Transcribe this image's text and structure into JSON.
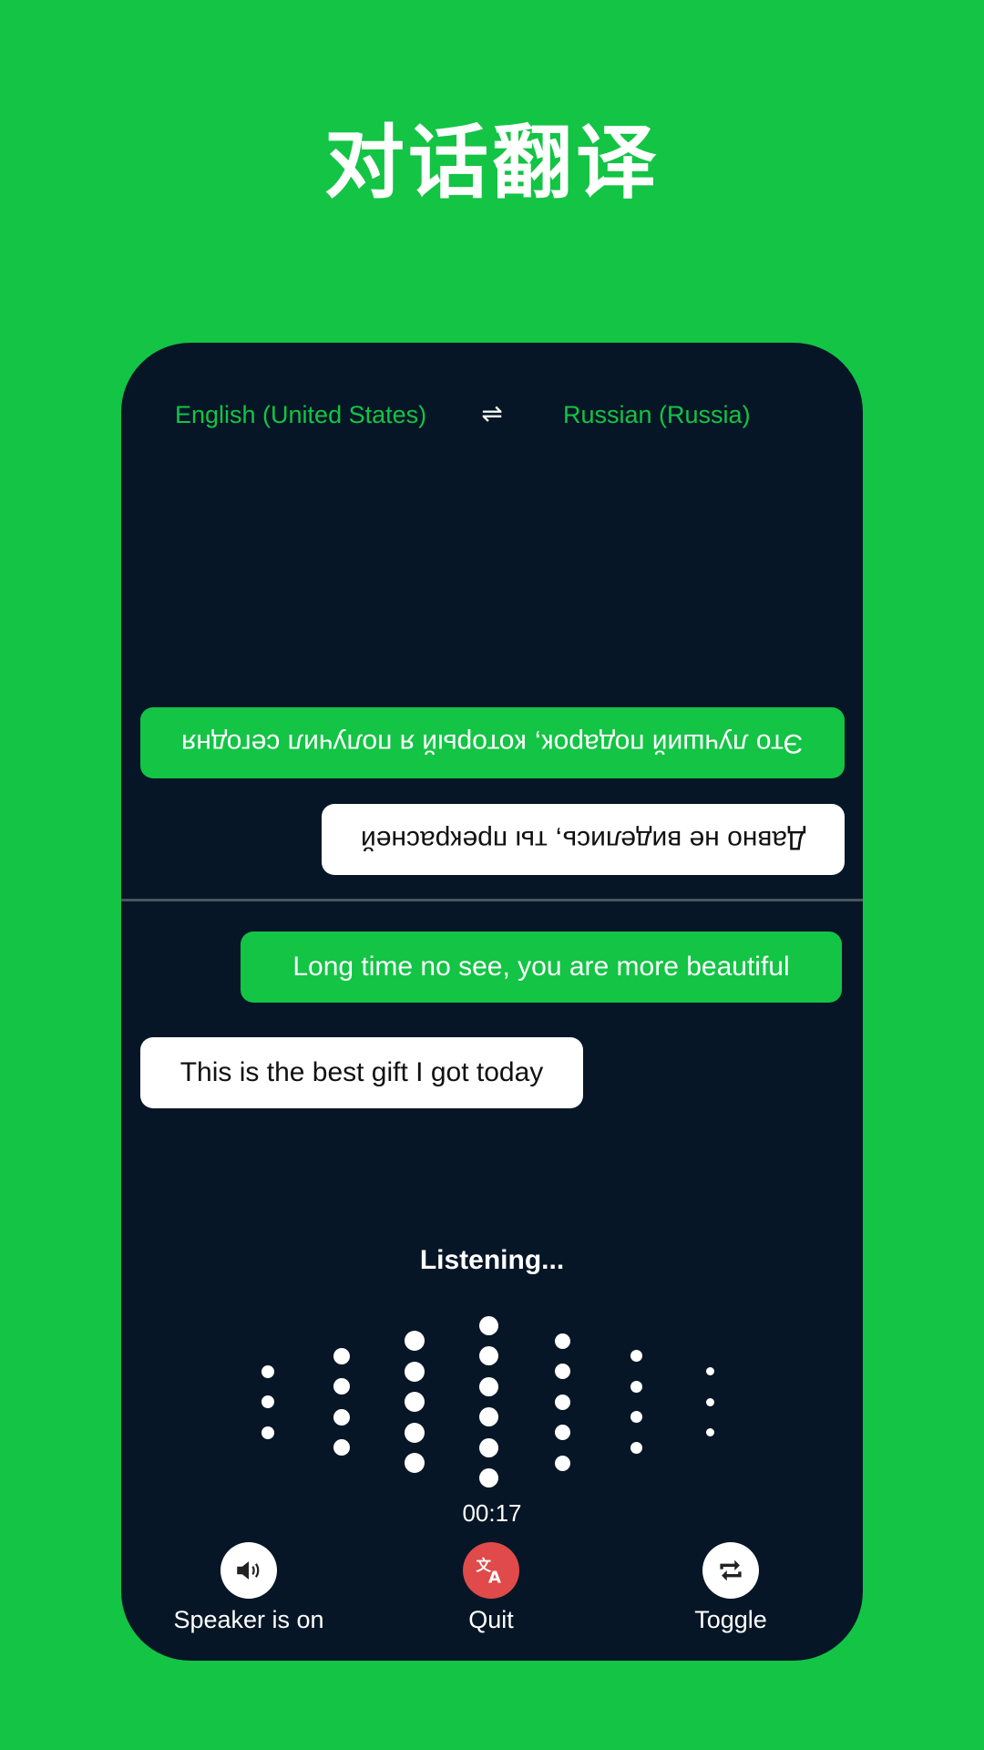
{
  "header": {
    "title": "对话翻译"
  },
  "languages": {
    "source": "English (United States)",
    "target": "Russian (Russia)",
    "swap_icon": "swap-arrows-icon"
  },
  "conversation_top": {
    "orientation": "rotated-180",
    "messages": [
      {
        "text": "Это лучший подарок, который я получил сегодня",
        "style": "green"
      },
      {
        "text": "Давно не виделись, ты прекрасней",
        "style": "white"
      }
    ]
  },
  "conversation_bottom": {
    "messages": [
      {
        "text": "Long time no see, you are more beautiful",
        "style": "green"
      },
      {
        "text": "This is the best gift I got today",
        "style": "white"
      }
    ]
  },
  "status": {
    "label": "Listening...",
    "timer": "00:17"
  },
  "waveform": {
    "dots_per_column": [
      3,
      4,
      5,
      6,
      5,
      4,
      3
    ]
  },
  "controls": [
    {
      "label": "Speaker is on",
      "icon": "speaker-icon"
    },
    {
      "label": "Quit",
      "icon": "translate-icon"
    },
    {
      "label": "Toggle",
      "icon": "repeat-icon"
    }
  ],
  "colors": {
    "brand_green": "#13C445",
    "panel": "#061626",
    "quit_red": "#E04A4A"
  }
}
